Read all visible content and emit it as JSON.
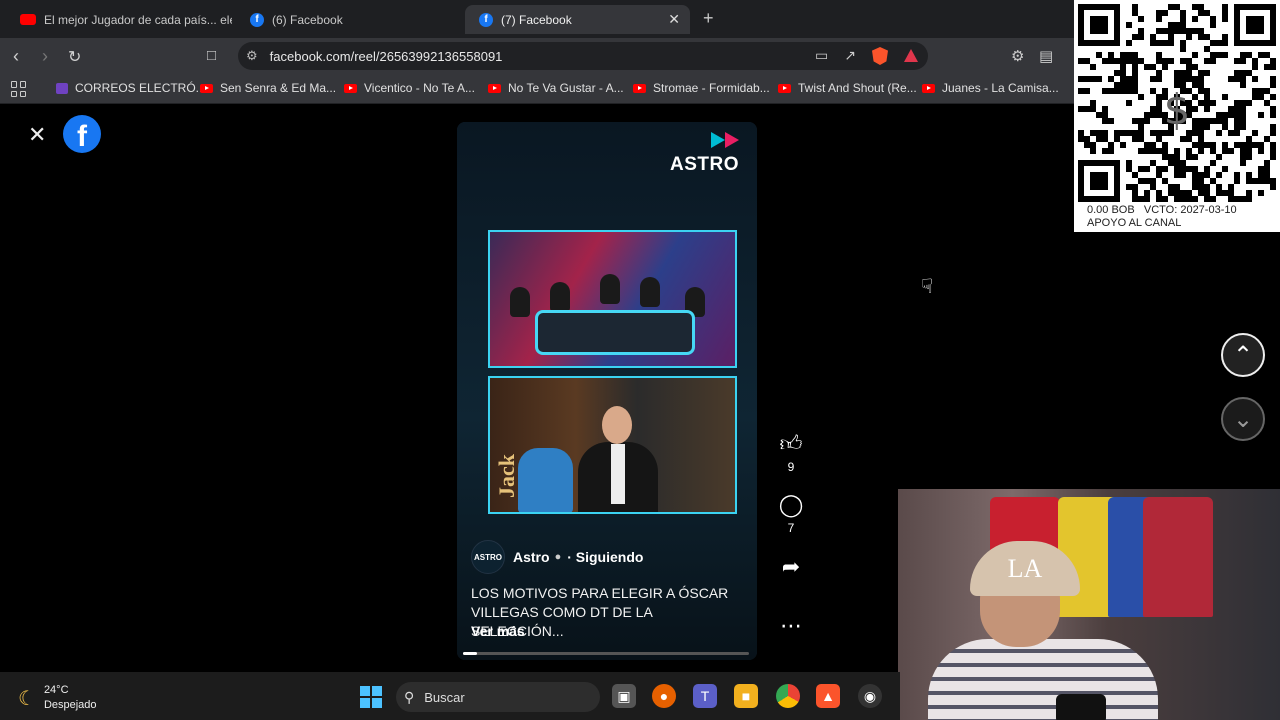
{
  "tabs": [
    {
      "title": "El mejor Jugador de cada país... elegir",
      "icon": "youtube-icon",
      "active": false
    },
    {
      "title": "(6) Facebook",
      "icon": "facebook-icon",
      "active": false
    },
    {
      "title": "(7) Facebook",
      "icon": "facebook-icon",
      "active": true
    }
  ],
  "address_bar": {
    "url": "facebook.com/reel/26563992136558091"
  },
  "bookmarks": [
    {
      "label": "CORREOS ELECTRÓ...",
      "icon": "list-icon"
    },
    {
      "label": "Sen Senra & Ed Ma...",
      "icon": "youtube-icon"
    },
    {
      "label": "Vicentico - No Te A...",
      "icon": "youtube-icon"
    },
    {
      "label": "No Te Va Gustar - A...",
      "icon": "youtube-icon"
    },
    {
      "label": "Stromae - Formidab...",
      "icon": "youtube-icon"
    },
    {
      "label": "Twist And Shout (Re...",
      "icon": "youtube-icon"
    },
    {
      "label": "Juanes - La Camisa...",
      "icon": "youtube-icon"
    }
  ],
  "reel": {
    "brand": "ASTRO",
    "avatar_text": "ASTRO",
    "account_name": "Astro",
    "follow_status": "· Siguiendo",
    "caption": "LOS MOTIVOS PARA ELEGIR A ÓSCAR VILLEGAS COMO DT DE LA SELECCIÓN...",
    "see_more": "Ver más",
    "set_sign_text": "Jack",
    "progress": 0.05
  },
  "actions": {
    "likes": "9",
    "comments": "7"
  },
  "qr_overlay": {
    "line1": "0.00 BOB   VCTO: 2027-03-10",
    "line2": "APOYO AL CANAL"
  },
  "webcam": {
    "cap_logo": "LA"
  },
  "taskbar": {
    "temperature": "24°C",
    "condition": "Despejado",
    "search_placeholder": "Buscar"
  },
  "colors": {
    "facebook_blue": "#1877f2",
    "reel_accent": "#3bd3f2",
    "taskbar_bg": "#1c1c1c"
  }
}
